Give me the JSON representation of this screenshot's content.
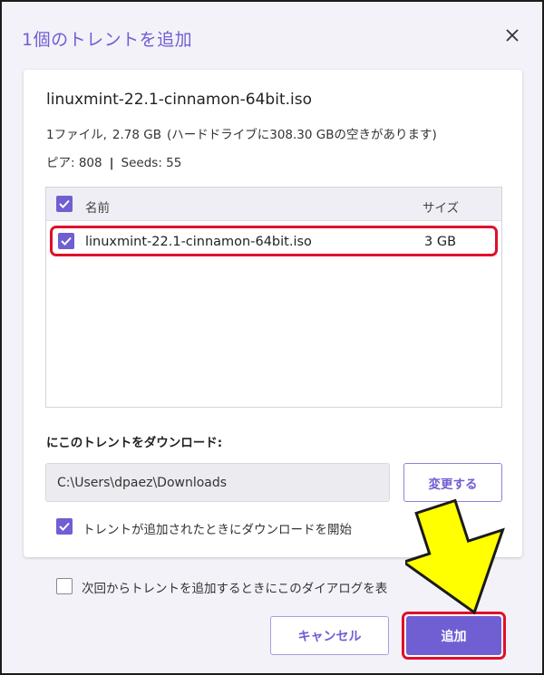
{
  "dialog": {
    "title": "1個のトレントを追加"
  },
  "torrent": {
    "name": "linuxmint-22.1-cinnamon-64bit.iso",
    "file_count_label": "1ファイル,",
    "total_size": "2.78 GB",
    "free_space_text": "(ハードドライブに308.30 GBの空きがあります)",
    "peers_label": "ピア: 808",
    "seeds_label": "Seeds: 55"
  },
  "file_table": {
    "header_name": "名前",
    "header_size": "サイズ",
    "rows": [
      {
        "name": "linuxmint-22.1-cinnamon-64bit.iso",
        "size": "3 GB",
        "checked": true
      }
    ]
  },
  "download": {
    "label": "にこのトレントをダウンロード:",
    "path_value": "C:\\Users\\dpaez\\Downloads",
    "change_button": "変更する"
  },
  "options": {
    "start_download_label": "トレントが追加されたときにダウンロードを開始",
    "dont_show_again_label": "次回からトレントを追加するときにこのダイアログを表"
  },
  "buttons": {
    "cancel": "キャンセル",
    "add": "追加"
  },
  "colors": {
    "accent": "#6f5fd2",
    "highlight": "#e0102a",
    "arrow_fill": "#ffff00"
  },
  "icons": {
    "close": "close-icon",
    "check": "checkmark-icon",
    "arrow": "arrow-down-right-icon"
  }
}
